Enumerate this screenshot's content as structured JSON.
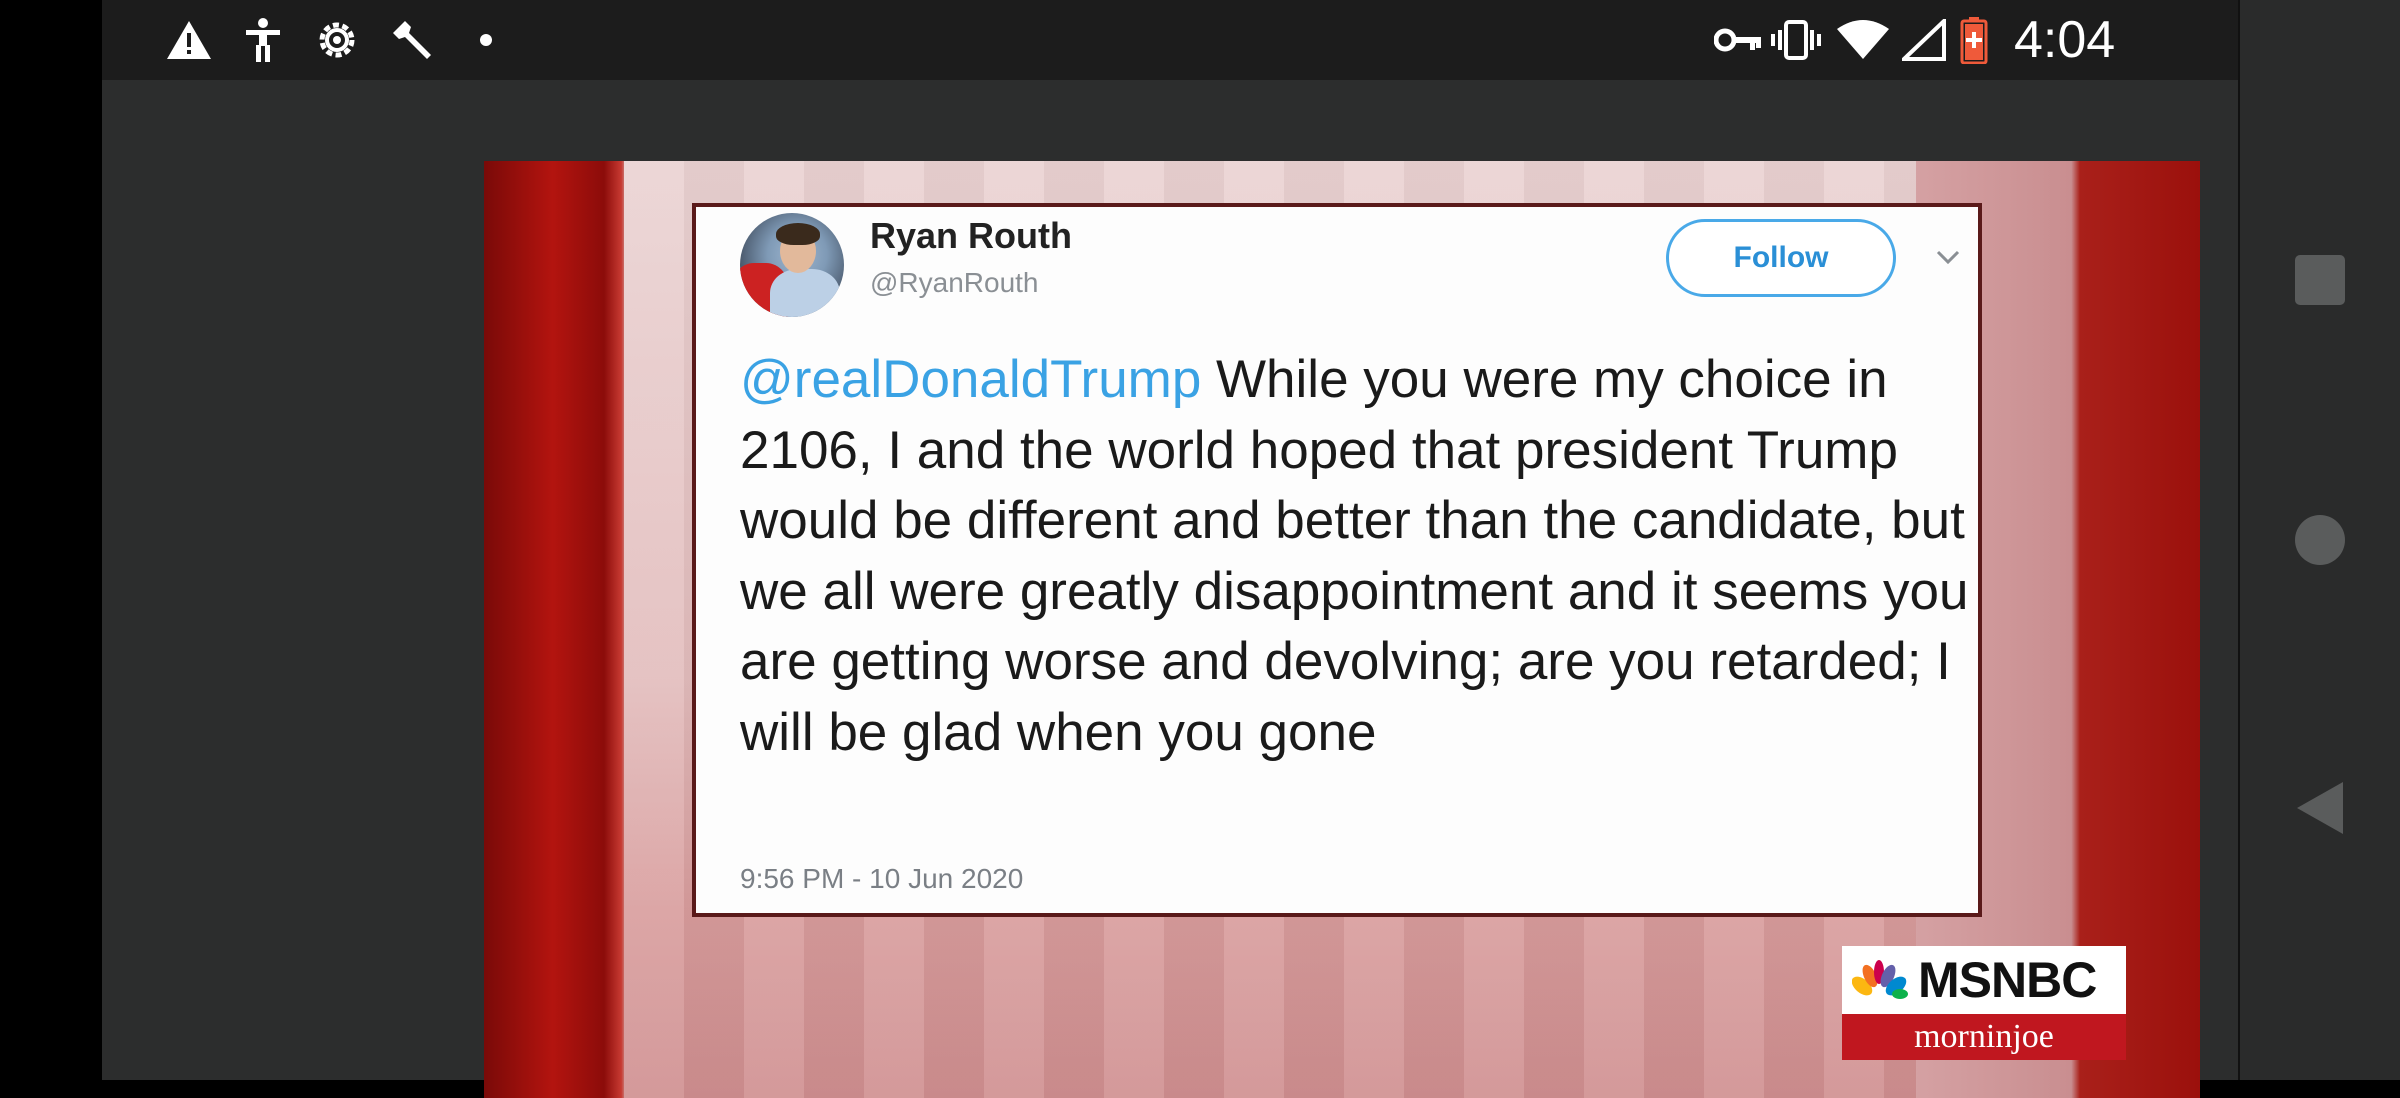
{
  "status_bar": {
    "time": "4:04",
    "left_icons": [
      "warning-icon",
      "accessibility-icon",
      "settings-icon",
      "wrench-icon",
      "dot-icon"
    ],
    "right_icons": [
      "vpn-key-icon",
      "vibrate-icon",
      "wifi-icon",
      "cell-signal-icon",
      "battery-icon"
    ]
  },
  "tweet": {
    "display_name": "Ryan Routh",
    "handle": "@RyanRouth",
    "follow_label": "Follow",
    "mention": "@realDonaldTrump",
    "body": " While you were my choice in 2106, I and the world hoped that president Trump would be different and better than the candidate, but we all were greatly disappointment and it seems you are getting worse and devolving; are you retarded; I will be glad when you gone",
    "timestamp": "9:56 PM - 10 Jun 2020"
  },
  "broadcast_bug": {
    "network": "MSNBC",
    "show": "morninjoe"
  },
  "nav_bar": {
    "buttons": [
      "recents-square-icon",
      "home-circle-icon",
      "back-triangle-icon"
    ]
  },
  "colors": {
    "accent_link": "#3aa2e4",
    "follow_border": "#49a9e8",
    "msnbc_red": "#c0171f",
    "status_bar_bg": "#1c1c1c",
    "app_bg": "#2c2d2d"
  }
}
